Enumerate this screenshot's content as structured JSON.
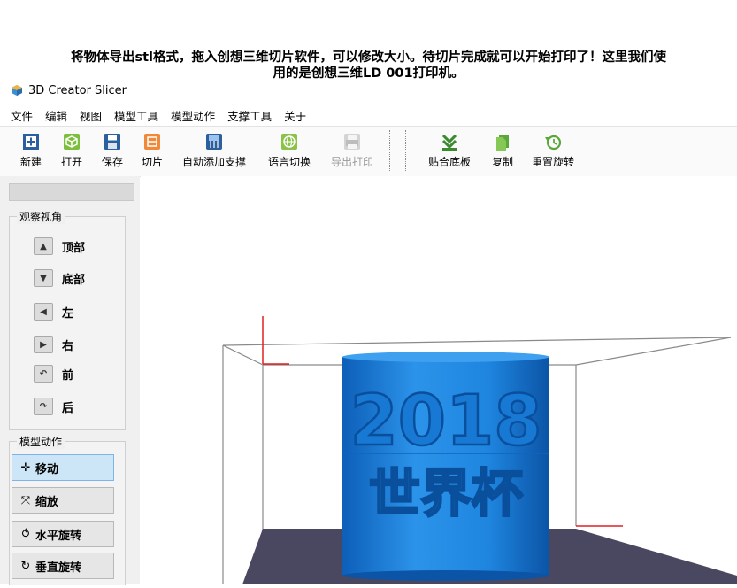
{
  "caption": {
    "line1": "将物体导出stl格式，拖入创想三维切片软件，可以修改大小。待切片完成就可以开始打印了！这里我们使",
    "line2": "用的是创想三维LD   001打印机。"
  },
  "app": {
    "title": "3D Creator Slicer"
  },
  "menu": [
    "文件",
    "编辑",
    "视图",
    "模型工具",
    "模型动作",
    "支撑工具",
    "关于"
  ],
  "toolbar": {
    "new": "新建",
    "open": "打开",
    "save": "保存",
    "slice": "切片",
    "auto_support": "自动添加支撑",
    "language": "语言切换",
    "export_print": "导出打印",
    "snap_bed": "贴合底板",
    "copy": "复制",
    "reset_rotation": "重置旋转"
  },
  "view_panel": {
    "title": "观察视角",
    "items": [
      "顶部",
      "底部",
      "左",
      "右",
      "前",
      "后"
    ]
  },
  "action_panel": {
    "title": "模型动作",
    "items": [
      "移动",
      "缩放",
      "水平旋转",
      "垂直旋转"
    ]
  },
  "model": {
    "text_year": "2018",
    "text_words": "世界杯"
  },
  "colors": {
    "model": "#1f86e0",
    "platform": "#4a4760",
    "accent_active": "#cde6f7"
  }
}
